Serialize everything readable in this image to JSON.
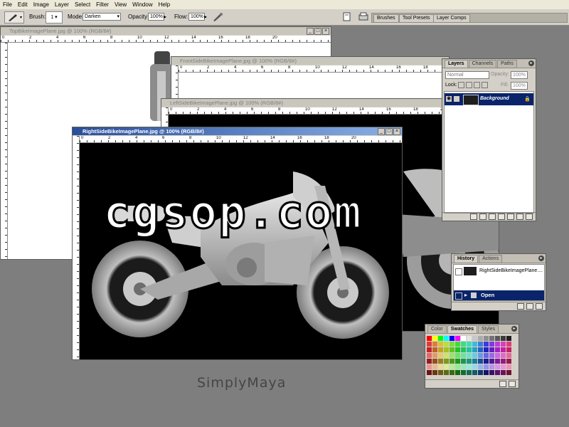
{
  "menu": [
    "File",
    "Edit",
    "Image",
    "Layer",
    "Select",
    "Filter",
    "View",
    "Window",
    "Help"
  ],
  "options": {
    "brush_label": "Brush:",
    "brush_size": "1",
    "mode_label": "Mode:",
    "mode_value": "Darken",
    "opacity_label": "Opacity:",
    "opacity_value": "100%",
    "flow_label": "Flow:",
    "flow_value": "100%"
  },
  "palette_well": [
    "Brushes",
    "Tool Presets",
    "Layer Comps"
  ],
  "documents": {
    "top": {
      "title": "TopBikeImagePlane.jpg @ 100% (RGB/8#)"
    },
    "front": {
      "title": "FrontSideBikeImagePlane.jpg @ 100% (RGB/8#)"
    },
    "left": {
      "title": "LeftSideBikeImagePlane.jpg @ 100% (RGB/8#)"
    },
    "right": {
      "title": "RightSideBikeImagePlane.jpg @ 100% (RGB/8#)"
    }
  },
  "ruler_ticks": [
    "0",
    "2",
    "4",
    "6",
    "8",
    "10",
    "12",
    "14",
    "16",
    "18",
    "20"
  ],
  "layers_panel": {
    "tabs": [
      "Layers",
      "Channels",
      "Paths"
    ],
    "blend_mode": "Normal",
    "opacity_label": "Opacity:",
    "opacity_value": "100%",
    "lock_label": "Lock:",
    "fill_label": "Fill:",
    "fill_value": "100%",
    "layer_name": "Background"
  },
  "history_panel": {
    "tabs": [
      "History",
      "Actions"
    ],
    "snapshot_name": "RightSideBikeImagePlane....",
    "step_name": "Open"
  },
  "swatches_panel": {
    "tabs": [
      "Color",
      "Swatches",
      "Styles"
    ]
  },
  "watermark": "cgsop.com",
  "credit": "SimplyMaya",
  "colors": {
    "desktop": "#7e7e7e",
    "panel": "#d4d0c8",
    "active_title": "#2a4e9a",
    "selection": "#0a246a"
  }
}
